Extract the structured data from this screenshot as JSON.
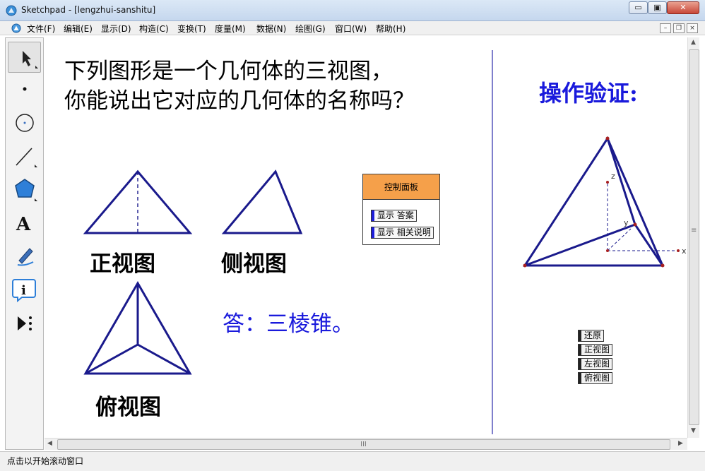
{
  "window": {
    "app_name": "Sketchpad",
    "document": " - [lengzhui-sanshitu]",
    "min_glyph": "▭",
    "max_glyph": "▣",
    "close_glyph": "✕"
  },
  "menu": {
    "items": [
      "文件(F)",
      "编辑(E)",
      "显示(D)",
      "构造(C)",
      "变换(T)",
      "度量(M)",
      "数据(N)",
      "绘图(G)",
      "窗口(W)",
      "帮助(H)"
    ],
    "mdi_min": "–",
    "mdi_restore": "❐",
    "mdi_close": "×"
  },
  "toolbox": {
    "tools": [
      "arrow-select-icon",
      "point-icon",
      "compass-circle-icon",
      "straightedge-line-icon",
      "polygon-icon",
      "text-tool-icon",
      "marker-pen-icon",
      "information-icon",
      "custom-tools-icon"
    ],
    "text_tool_glyph": "A",
    "info_glyph": "i"
  },
  "canvas": {
    "question_line1": "下列图形是一个几何体的三视图，",
    "question_line2": "你能说出它对应的几何体的名称吗？",
    "front_view_label": "正视图",
    "side_view_label": "侧视图",
    "top_view_label": "俯视图",
    "answer": "答：三棱锥。",
    "verify_title": "操作验证:",
    "axis_z": "z",
    "axis_y": "y",
    "axis_x": "x",
    "colors": {
      "shape_stroke": "#1a1a8c",
      "answer_text": "#1a1adc",
      "panel_header": "#f5a04a"
    }
  },
  "control_panel": {
    "title": "控制面板",
    "show_answer": "显示 答案",
    "show_notes": "显示 相关说明"
  },
  "actions": {
    "restore": "还原",
    "front_view": "正视图",
    "left_view": "左视图",
    "top_view": "俯视图"
  },
  "scrollbars": {
    "up": "▲",
    "down": "▼",
    "left": "◀",
    "right": "▶",
    "grip_h": "III",
    "grip_v": "≡"
  },
  "status": {
    "text": "点击以开始滚动窗口"
  }
}
